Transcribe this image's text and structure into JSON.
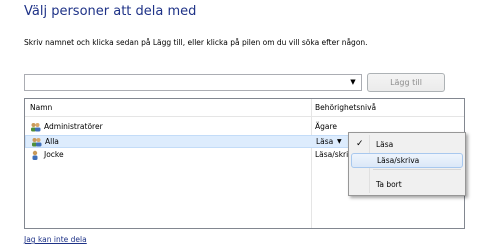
{
  "title": "Välj personer att dela med",
  "instruction": "Skriv namnet och klicka sedan på Lägg till, eller klicka på pilen om du vill söka efter någon.",
  "combo": {
    "value": "",
    "arrow_icon": "chevron-down-icon"
  },
  "add_button": {
    "label": "Lägg till",
    "enabled": false
  },
  "list": {
    "columns": [
      "Namn",
      "Behörighetsnivå"
    ],
    "rows": [
      {
        "name": "Administratörer",
        "permission": "Ägare",
        "icon": "user-group-icon"
      },
      {
        "name": "Alla",
        "permission": "Läsa",
        "icon": "user-group-icon",
        "selected": true,
        "has_dropdown": true
      },
      {
        "name": "Jocke",
        "permission": "Läsa/skriva",
        "icon": "user-icon"
      }
    ]
  },
  "menu": {
    "items": [
      {
        "label": "Läsa",
        "checked": true
      },
      {
        "label": "Läsa/skriva",
        "hovered": true
      },
      {
        "label": "Ta bort"
      }
    ]
  },
  "link": "Jag kan inte dela",
  "colors": {
    "title": "#1e3287",
    "selection": "#ddecfd",
    "menu_hover": "#dbe8f8"
  }
}
